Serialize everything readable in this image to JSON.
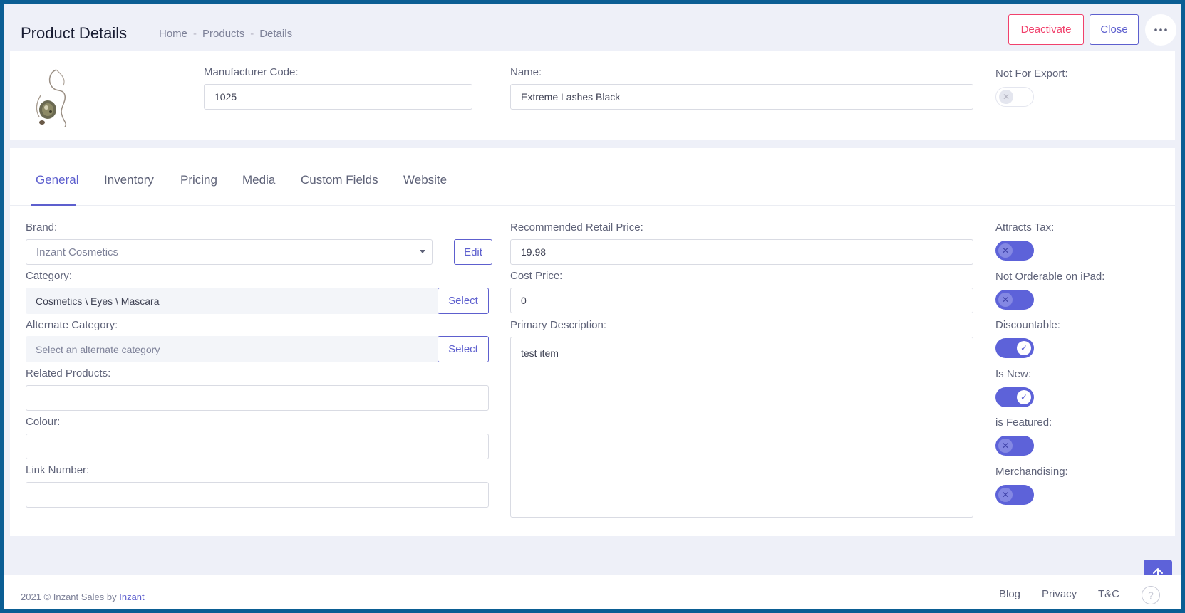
{
  "header": {
    "title": "Product Details",
    "breadcrumb": [
      "Home",
      "Products",
      "Details"
    ],
    "breadcrumb_sep": "-",
    "deactivate_label": "Deactivate",
    "close_label": "Close",
    "more_icon": "ellipsis-icon"
  },
  "product": {
    "manufacturer_code_label": "Manufacturer Code:",
    "manufacturer_code": "1025",
    "name_label": "Name:",
    "name": "Extreme Lashes Black",
    "not_for_export_label": "Not For Export:",
    "not_for_export": false
  },
  "tabs": [
    {
      "label": "General",
      "active": true
    },
    {
      "label": "Inventory",
      "active": false
    },
    {
      "label": "Pricing",
      "active": false
    },
    {
      "label": "Media",
      "active": false
    },
    {
      "label": "Custom Fields",
      "active": false
    },
    {
      "label": "Website",
      "active": false
    }
  ],
  "general": {
    "brand_label": "Brand:",
    "brand_value": "Inzant Cosmetics",
    "edit_label": "Edit",
    "category_label": "Category:",
    "category_value": "Cosmetics \\ Eyes \\ Mascara",
    "select_label": "Select",
    "alt_category_label": "Alternate Category:",
    "alt_category_placeholder": "Select an alternate category",
    "related_label": "Related Products:",
    "related_value": "",
    "colour_label": "Colour:",
    "colour_value": "",
    "link_label": "Link Number:",
    "link_value": "",
    "rrp_label": "Recommended Retail Price:",
    "rrp_value": "19.98",
    "cost_label": "Cost Price:",
    "cost_value": "0",
    "desc_label": "Primary Description:",
    "desc_value": "test item"
  },
  "flags": [
    {
      "label": "Attracts Tax:",
      "on": false
    },
    {
      "label": "Not Orderable on iPad:",
      "on": false
    },
    {
      "label": "Discountable:",
      "on": true
    },
    {
      "label": "Is New:",
      "on": true
    },
    {
      "label": "is Featured:",
      "on": false
    },
    {
      "label": "Merchandising:",
      "on": false
    }
  ],
  "footer": {
    "copyright": "2021 © Inzant Sales by",
    "brand": "Inzant",
    "links": [
      "Blog",
      "Privacy",
      "T&C"
    ],
    "help_icon": "help-icon"
  },
  "colors": {
    "accent": "#5d5fce",
    "danger": "#f1416c",
    "frame": "#0b5e94"
  }
}
